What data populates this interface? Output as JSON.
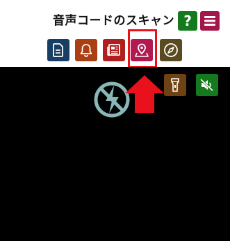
{
  "header": {
    "title": "音声コードのスキャン",
    "help_label": "?"
  },
  "modes": [
    {
      "name": "document",
      "icon": "document-icon",
      "color": "#183e63"
    },
    {
      "name": "notification",
      "icon": "bell-icon",
      "color": "#a93f12"
    },
    {
      "name": "newspaper",
      "icon": "newspaper-icon",
      "color": "#b01e1e"
    },
    {
      "name": "location",
      "icon": "map-pin-icon",
      "color": "#b11a50",
      "highlighted": true
    },
    {
      "name": "compass",
      "icon": "compass-icon",
      "color": "#5a4a1f"
    }
  ],
  "camera": {
    "torch_icon": "flashlight-icon",
    "mute_icon": "volume-mute-icon",
    "flash_state_icon": "flash-off-icon"
  },
  "colors": {
    "help_green": "#157a1d",
    "menu_magenta": "#a4174a",
    "highlight_red": "#e8111c",
    "camera_bg": "#000000"
  }
}
